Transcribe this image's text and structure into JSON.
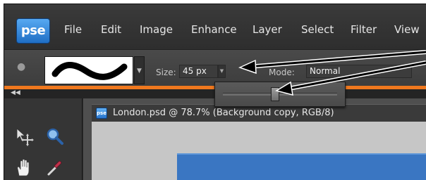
{
  "app": {
    "logo_text": "pse",
    "brand_color": "#2f86de",
    "accent_color": "#f0781e"
  },
  "menu": {
    "items": [
      "File",
      "Edit",
      "Image",
      "Enhance",
      "Layer",
      "Select",
      "Filter",
      "View"
    ]
  },
  "options_bar": {
    "tool_preset_icon": "tool-preset-icon",
    "size_label": "Size:",
    "size_value": "45 px",
    "mode_label": "Mode:",
    "mode_value": "Normal",
    "size_slider_level": 0.45
  },
  "document": {
    "tab_icon_text": "pse",
    "title": "London.psd @ 78.7% (Background copy, RGB/8)"
  },
  "toolbox": {
    "tools": [
      "move-tool-icon",
      "zoom-tool-icon",
      "hand-tool-icon",
      "eyedropper-tool-icon"
    ]
  }
}
